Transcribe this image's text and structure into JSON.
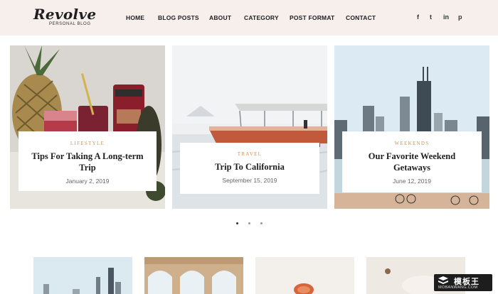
{
  "brand": {
    "title": "Revolve",
    "subtitle": "PERSONAL BLOG"
  },
  "nav": [
    "HOME",
    "BLOG POSTS",
    "ABOUT",
    "CATEGORY",
    "POST FORMAT",
    "CONTACT"
  ],
  "social": [
    {
      "glyph": "f",
      "icon": "facebook-icon"
    },
    {
      "glyph": "t",
      "icon": "twitter-icon"
    },
    {
      "glyph": "in",
      "icon": "linkedin-icon"
    },
    {
      "glyph": "p",
      "icon": "pinterest-icon"
    }
  ],
  "cards": [
    {
      "category": "LIFESTYLE",
      "title_line1": "Tips For Taking A Long-term",
      "title_line2": "Trip",
      "date": "January 2, 2019"
    },
    {
      "category": "TRAVEL",
      "title_line1": "Trip To California",
      "title_line2": "",
      "date": "September 15, 2019"
    },
    {
      "category": "WEEKENDS",
      "title_line1": "Our Favorite Weekend",
      "title_line2": "Getaways",
      "date": "June 12, 2019"
    }
  ],
  "slider": {
    "dots": 3,
    "active_index": 0
  },
  "watermark": {
    "cn": "模板王",
    "url": "MOBANWANG.COM"
  },
  "colors": {
    "header_bg": "#f6efec",
    "category": "#c9945c",
    "text_dark": "#1e1e1e"
  }
}
